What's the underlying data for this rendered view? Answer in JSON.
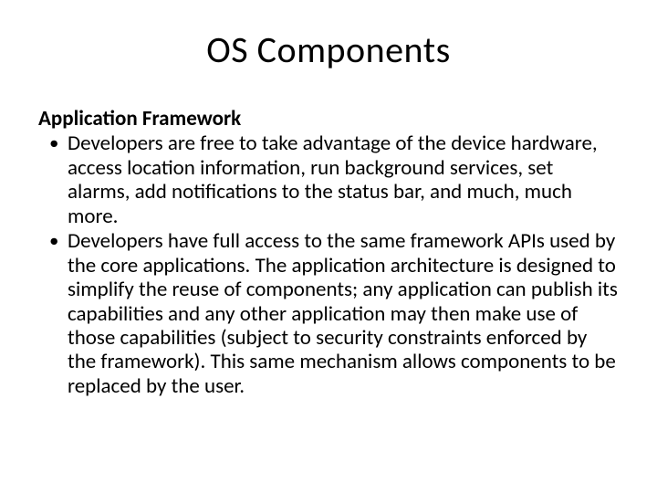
{
  "slide": {
    "title": "OS Components",
    "section_heading": "Application Framework",
    "bullets": [
      "Developers are free to take advantage of the device hardware, access location information, run background services, set alarms, add notifications to the status bar, and much, much more.",
      "Developers have full access to the same framework APIs used by the core applications. The application architecture is designed to simplify the reuse of components; any application can publish its capabilities and any other application may then make use of those capabilities (subject to security constraints enforced by the framework). This same mechanism allows components to be replaced by the user."
    ]
  }
}
